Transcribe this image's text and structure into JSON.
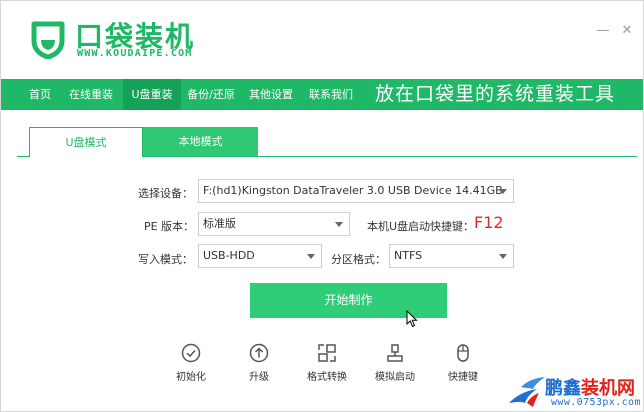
{
  "brand": {
    "title": "口袋装机",
    "url": "WWW.KOUDAIPE.COM"
  },
  "window_controls": [
    "—",
    "✕"
  ],
  "nav": {
    "items": [
      {
        "label": "首页",
        "active": false
      },
      {
        "label": "在线重装",
        "active": false
      },
      {
        "label": "U盘重装",
        "active": true
      },
      {
        "label": "备份/还原",
        "active": false
      },
      {
        "label": "其他设置",
        "active": false
      },
      {
        "label": "联系我们",
        "active": false
      }
    ],
    "slogan": "放在口袋里的系统重装工具"
  },
  "tabs": [
    {
      "label": "U盘模式",
      "active": true
    },
    {
      "label": "本地模式",
      "active": false
    }
  ],
  "form": {
    "device_label": "选择设备：",
    "device_value": "F:(hd1)Kingston DataTraveler 3.0 USB Device 14.41GB",
    "pe_label": "PE 版本：",
    "pe_value": "标准版",
    "hotkey_label": "本机U盘启动快捷键：",
    "hotkey_value": "F12",
    "write_label": "写入模式：",
    "write_value": "USB-HDD",
    "partition_label": "分区格式：",
    "partition_value": "NTFS"
  },
  "start_button": "开始制作",
  "tools": [
    {
      "label": "初始化",
      "icon": "check-circle-icon"
    },
    {
      "label": "升级",
      "icon": "arrow-up-circle-icon"
    },
    {
      "label": "格式转换",
      "icon": "convert-icon"
    },
    {
      "label": "模拟启动",
      "icon": "boot-simulate-icon"
    },
    {
      "label": "快捷键",
      "icon": "mouse-icon"
    }
  ],
  "watermark": {
    "title_blue": "鹏鑫",
    "title_red": "装机网",
    "url": "www.0753px.com"
  },
  "colors": {
    "brand_green": "#1fb866",
    "nav_active": "#14a356",
    "button_green": "#2fcd78",
    "hotkey_red": "#e02a2a",
    "watermark_blue": "#1e6fd1"
  }
}
